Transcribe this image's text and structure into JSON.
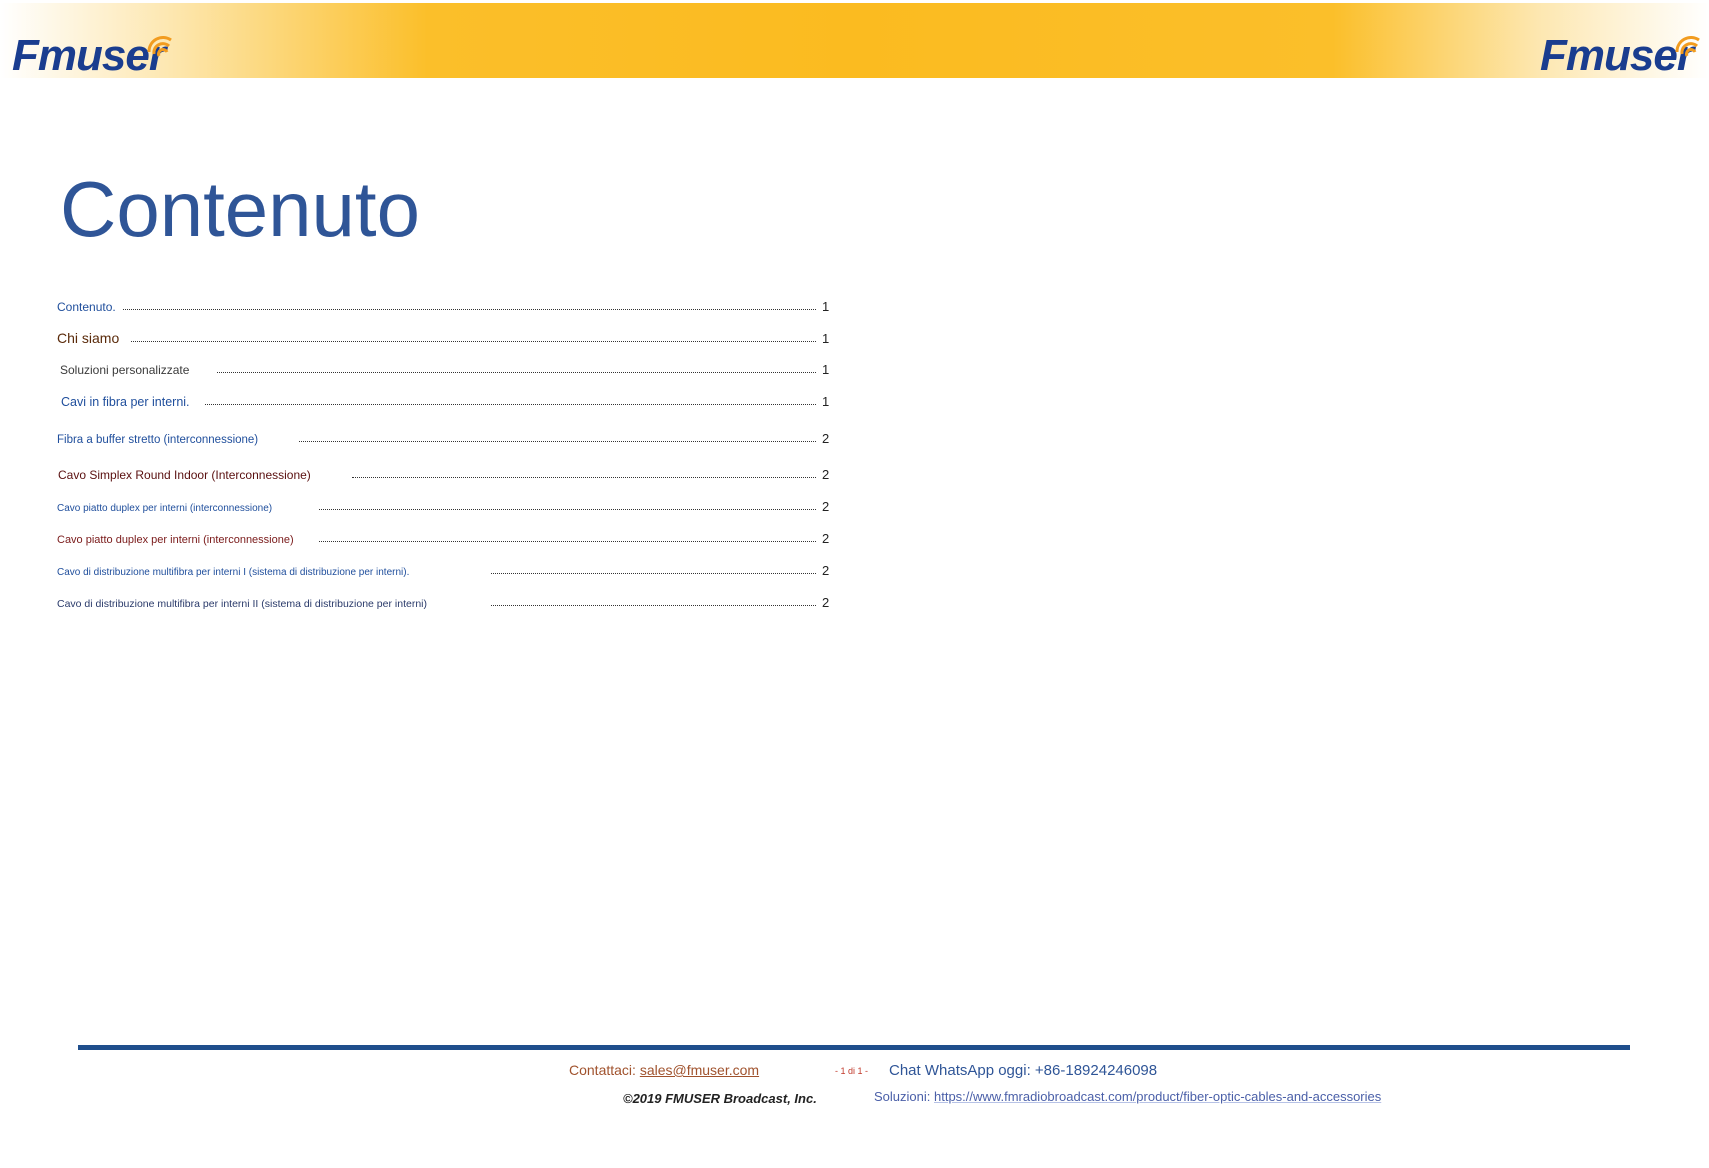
{
  "header": {
    "logo_left_text": "Fmuser",
    "logo_right_text": "Fmuser",
    "brand_color": "#1a3d8f",
    "band_color": "#fbbb20",
    "wave_color": "#f29c1f"
  },
  "title": "Contenuto",
  "toc": {
    "entries": [
      {
        "label": "Contenuto.",
        "page": "1",
        "color": "#1f4e9c"
      },
      {
        "label": "Chi siamo",
        "page": "1",
        "color": "#5a2a0a"
      },
      {
        "label": "Soluzioni personalizzate",
        "page": "1",
        "color": "#3b3b3b"
      },
      {
        "label": "Cavi in fibra per interni.",
        "page": "1",
        "color": "#1f4e9c"
      },
      {
        "label": "Fibra a buffer stretto (interconnessione)",
        "page": "2",
        "color": "#1f4e9c"
      },
      {
        "label": "Cavo Simplex Round Indoor (Interconnessione)",
        "page": "2",
        "color": "#5a1010"
      },
      {
        "label": "Cavo piatto duplex per interni (interconnessione)",
        "page": "2",
        "color": "#1f4e9c"
      },
      {
        "label": "Cavo piatto duplex per interni (interconnessione)",
        "page": "2",
        "color": "#7a1a1a"
      },
      {
        "label": "Cavo di distribuzione multifibra per interni I (sistema di distribuzione per interni).",
        "page": "2",
        "color": "#1f4e9c"
      },
      {
        "label": "Cavo di distribuzione multifibra per interni II (sistema di distribuzione per interni)",
        "page": "2",
        "color": "#2a3a6a"
      }
    ]
  },
  "footer": {
    "contact_label": "Contattaci:",
    "contact_email": "sales@fmuser.com",
    "page_indicator": "- 1 di 1 -",
    "whatsapp": "Chat WhatsApp oggi: +86-18924246098",
    "copyright": "©2019 FMUSER Broadcast, Inc.",
    "solutions_label": "Soluzioni:",
    "solutions_url": "https://www.fmradiobroadcast.com/product/fiber-optic-cables-and-accessories",
    "rule_color": "#1f4e8c"
  }
}
